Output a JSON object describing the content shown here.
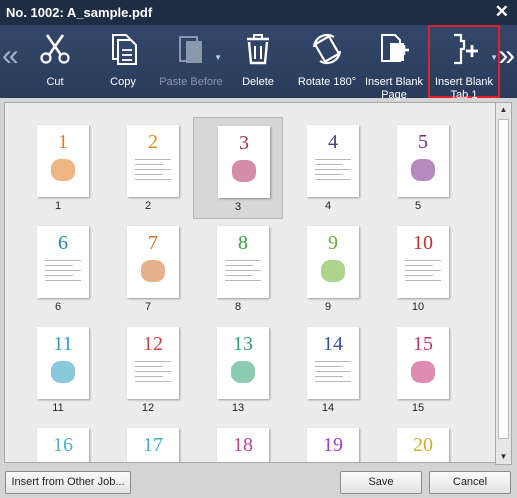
{
  "window": {
    "title": "No. 1002: A_sample.pdf"
  },
  "toolbar": {
    "buttons": [
      {
        "label": "Cut",
        "icon": "scissors-icon"
      },
      {
        "label": "Copy",
        "icon": "copy-icon"
      },
      {
        "label": "Paste Before",
        "icon": "paste-icon",
        "disabled": true
      },
      {
        "label": "Delete",
        "icon": "trash-icon"
      },
      {
        "label": "Rotate 180°",
        "icon": "rotate-icon"
      },
      {
        "label": "Insert Blank Page",
        "icon": "insert-page-icon"
      },
      {
        "label": "Insert Blank Tab 1",
        "icon": "insert-tab-icon",
        "selected": true
      }
    ]
  },
  "pages": [
    {
      "num": "1",
      "color": "#e07a1e"
    },
    {
      "num": "2",
      "color": "#d98b1a"
    },
    {
      "num": "3",
      "color": "#b03060"
    },
    {
      "num": "4",
      "color": "#4a3a8a"
    },
    {
      "num": "5",
      "color": "#7a2a8a"
    },
    {
      "num": "6",
      "color": "#1a8aa8"
    },
    {
      "num": "7",
      "color": "#d0702a"
    },
    {
      "num": "8",
      "color": "#3aa040"
    },
    {
      "num": "9",
      "color": "#6ab030"
    },
    {
      "num": "10",
      "color": "#c03030"
    },
    {
      "num": "11",
      "color": "#2a9ac0"
    },
    {
      "num": "12",
      "color": "#d04040"
    },
    {
      "num": "13",
      "color": "#30a070"
    },
    {
      "num": "14",
      "color": "#3050a0"
    },
    {
      "num": "15",
      "color": "#c03070"
    },
    {
      "num": "16",
      "color": "#4ab0d0"
    },
    {
      "num": "17",
      "color": "#3ab0c0"
    },
    {
      "num": "18",
      "color": "#c040a0"
    },
    {
      "num": "19",
      "color": "#a040c0"
    },
    {
      "num": "20",
      "color": "#d0b030"
    }
  ],
  "selected_page": "3",
  "bottom": {
    "insert_label": "Insert from Other Job...",
    "save_label": "Save",
    "cancel_label": "Cancel"
  }
}
